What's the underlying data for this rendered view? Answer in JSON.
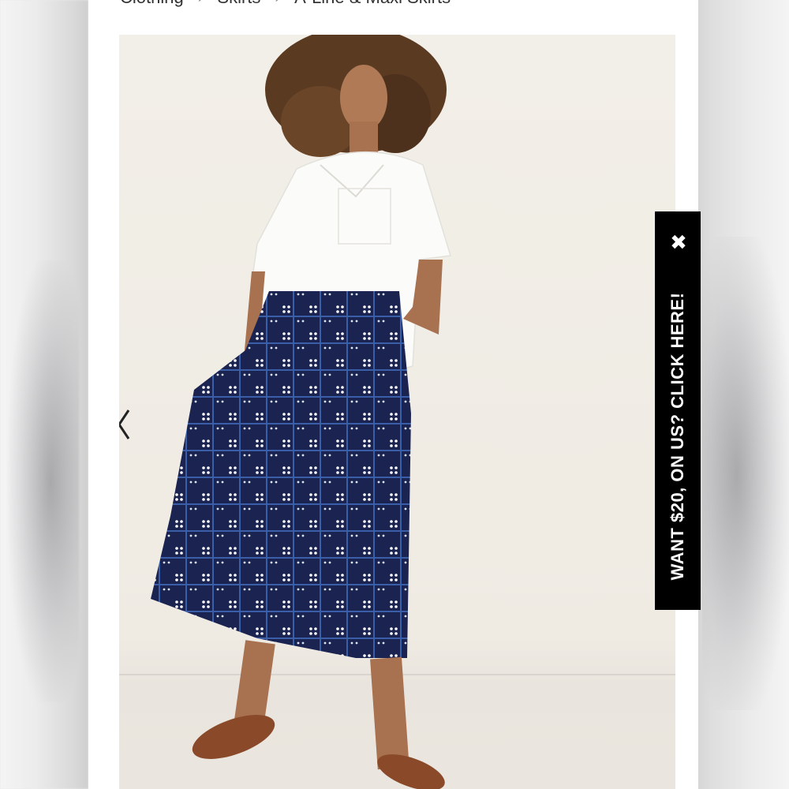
{
  "breadcrumb": {
    "items": [
      "Clothing",
      "Skirts",
      "A-Line & Maxi Skirts"
    ]
  },
  "product_image": {
    "alt": "Model wearing white short-sleeve shirt and navy windowpane midi skirt"
  },
  "promo": {
    "text": "WANT $20, ON US? CLICK HERE!",
    "close_glyph": "✖"
  },
  "colors": {
    "skirt": "#1b2451",
    "promo_bg": "#000000"
  }
}
